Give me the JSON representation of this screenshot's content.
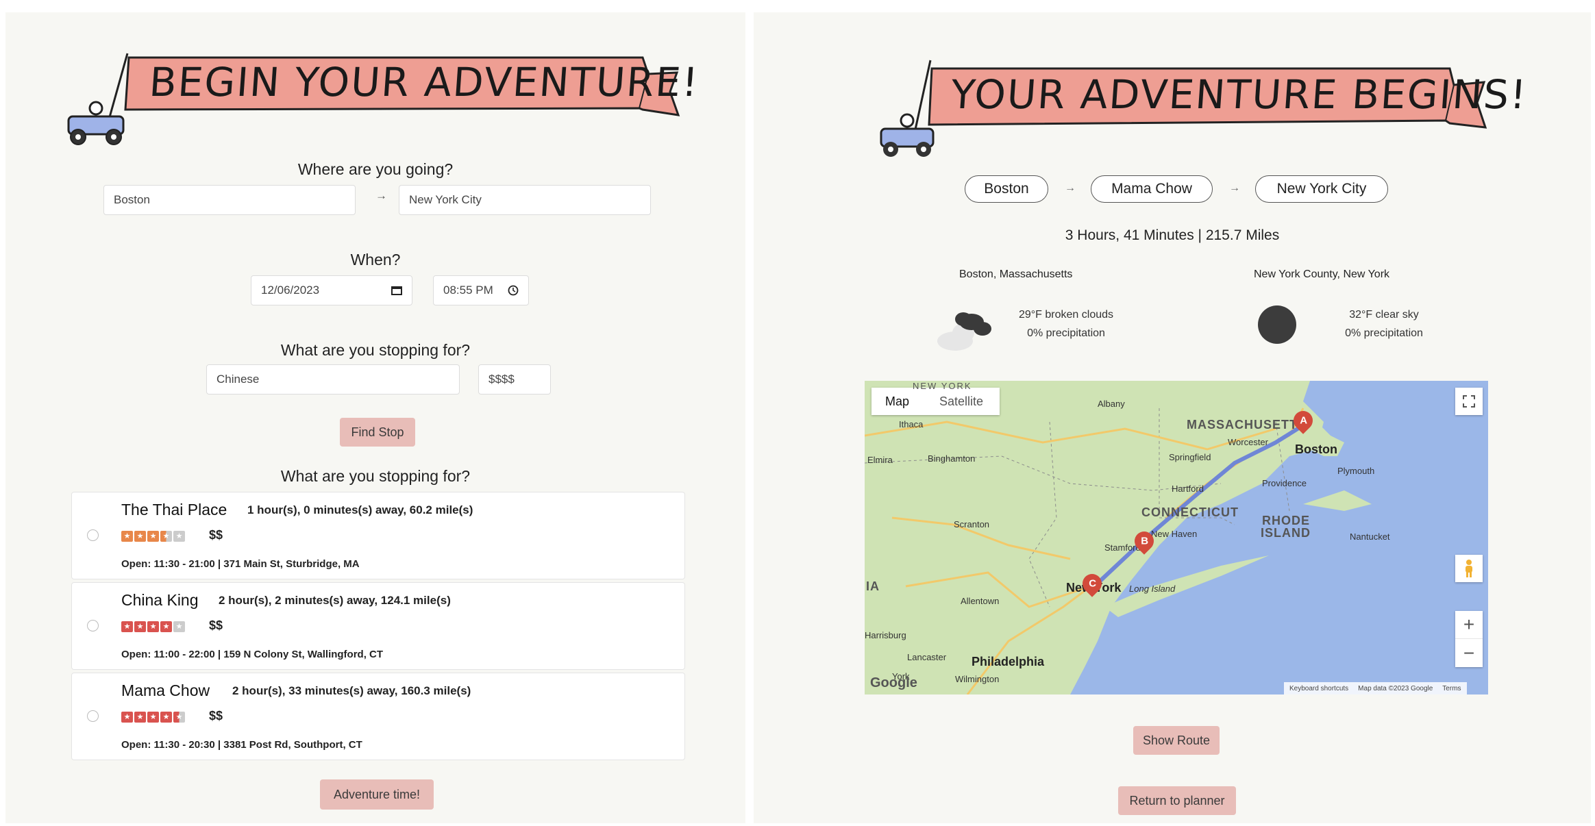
{
  "planner": {
    "banner_title": "BEGIN YOUR ADVENTURE!",
    "where_heading": "Where are you going?",
    "origin_value": "Boston",
    "destination_value": "New York City",
    "route_arrow": "→",
    "when_heading": "When?",
    "date_value": "12/06/2023",
    "time_value": "08:55 PM",
    "stopping_heading": "What are you stopping for?",
    "food_value": "Chinese",
    "price_value": "$$$$",
    "find_stop_label": "Find Stop",
    "results_heading": "What are you stopping for?",
    "results": [
      {
        "name": "The Thai Place",
        "detail": "1 hour(s), 0 minutes(s) away, 60.2 mile(s)",
        "rating": 3.5,
        "price": "$$",
        "hours": "Open: 11:30 - 21:00 | 371 Main St, Sturbridge, MA"
      },
      {
        "name": "China King",
        "detail": "2 hour(s), 2 minutes(s) away, 124.1 mile(s)",
        "rating": 4,
        "price": "$$",
        "hours": "Open: 11:00 - 22:00 | 159 N Colony St, Wallingford, CT"
      },
      {
        "name": "Mama Chow",
        "detail": "2 hour(s), 33 minutes(s) away, 160.3 mile(s)",
        "rating": 4.5,
        "price": "$$",
        "hours": "Open: 11:30 - 20:30 | 3381 Post Rd, Southport, CT"
      }
    ],
    "adventure_label": "Adventure time!"
  },
  "trip": {
    "banner_title": "YOUR ADVENTURE BEGINS!",
    "stops": [
      "Boston",
      "Mama Chow",
      "New York City"
    ],
    "arrow": "→",
    "summary": "3 Hours, 41 Minutes | 215.7 Miles",
    "weather": [
      {
        "location": "Boston, Massachusetts",
        "line1": "29°F broken clouds",
        "line2": "0% precipitation",
        "icon": "broken-clouds-icon"
      },
      {
        "location": "New York County, New York",
        "line1": "32°F clear sky",
        "line2": "0% precipitation",
        "icon": "clear-sky-night-icon"
      }
    ],
    "map": {
      "tab_map": "Map",
      "tab_satellite": "Satellite",
      "labels": {
        "new_york_top": "NEW YORK",
        "albany": "Albany",
        "ithaca": "Ithaca",
        "elmira": "Elmira",
        "binghamton": "Binghamton",
        "massachusetts": "MASSACHUSETTS",
        "worcester": "Worcester",
        "boston": "Boston",
        "springfield": "Springfield",
        "plymouth": "Plymouth",
        "providence": "Providence",
        "hartford": "Hartford",
        "connecticut": "CONNECTICUT",
        "rhode_island": "RHODE",
        "rhode_island2": "ISLAND",
        "nantucket": "Nantucket",
        "scranton": "Scranton",
        "new_haven": "New Haven",
        "stamford": "Stamford",
        "ia": "IA",
        "new_york_city": "New York",
        "long_island": "Long Island",
        "allentown": "Allentown",
        "harrisburg": "Harrisburg",
        "lancaster": "Lancaster",
        "philadelphia": "Philadelphia",
        "york": "York",
        "wilmington": "Wilmington"
      },
      "markers": [
        "A",
        "B",
        "C"
      ],
      "footer": {
        "shortcuts": "Keyboard shortcuts",
        "data": "Map data ©2023 Google",
        "terms": "Terms"
      },
      "google": "Google",
      "zoom_in": "+",
      "zoom_out": "−"
    },
    "show_route_label": "Show Route",
    "return_label": "Return to planner"
  },
  "colors": {
    "button": "#e8bdb8",
    "banner": "#ee9e93",
    "star_orange": "#e8874a",
    "star_red": "#d9534f",
    "map_water": "#9bb7e8",
    "map_land": "#cfe3b4"
  }
}
